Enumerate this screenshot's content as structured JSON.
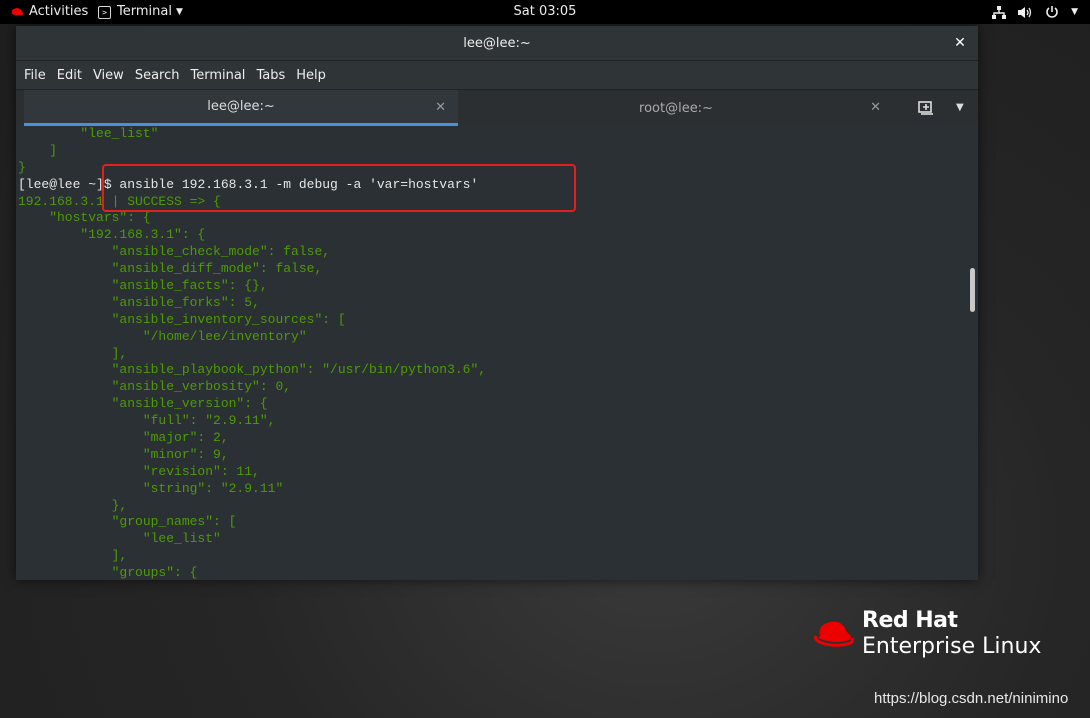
{
  "topbar": {
    "activities": "Activities",
    "app_name": "Terminal",
    "clock": "Sat 03:05"
  },
  "window": {
    "title": "lee@lee:~",
    "menu": [
      "File",
      "Edit",
      "View",
      "Search",
      "Terminal",
      "Tabs",
      "Help"
    ],
    "tabs": [
      {
        "label": "lee@lee:~",
        "active": true
      },
      {
        "label": "root@lee:~",
        "active": false
      }
    ]
  },
  "terminal": {
    "lines": [
      "        \"lee_list\"",
      "    ]",
      "}",
      "[lee@lee ~]$ ansible 192.168.3.1 -m debug -a 'var=hostvars'",
      "192.168.3.1 | SUCCESS => {",
      "    \"hostvars\": {",
      "        \"192.168.3.1\": {",
      "            \"ansible_check_mode\": false,",
      "            \"ansible_diff_mode\": false,",
      "            \"ansible_facts\": {},",
      "            \"ansible_forks\": 5,",
      "            \"ansible_inventory_sources\": [",
      "                \"/home/lee/inventory\"",
      "            ],",
      "            \"ansible_playbook_python\": \"/usr/bin/python3.6\",",
      "            \"ansible_verbosity\": 0,",
      "            \"ansible_version\": {",
      "                \"full\": \"2.9.11\",",
      "                \"major\": 2,",
      "                \"minor\": 9,",
      "                \"revision\": 11,",
      "                \"string\": \"2.9.11\"",
      "            },",
      "            \"group_names\": [",
      "                \"lee_list\"",
      "            ],",
      "            \"groups\": {"
    ],
    "colors": {
      "output": "#4e9a06",
      "command": "#e6e6e6",
      "background": "#2b3035"
    }
  },
  "branding": {
    "line1": "Red Hat",
    "line2": "Enterprise Linux"
  },
  "watermark": "https://blog.csdn.net/ninimino",
  "colors": {
    "highlight_box": "#e0201c",
    "redhat_red": "#ee0000",
    "tab_indicator": "#4a90d9"
  }
}
